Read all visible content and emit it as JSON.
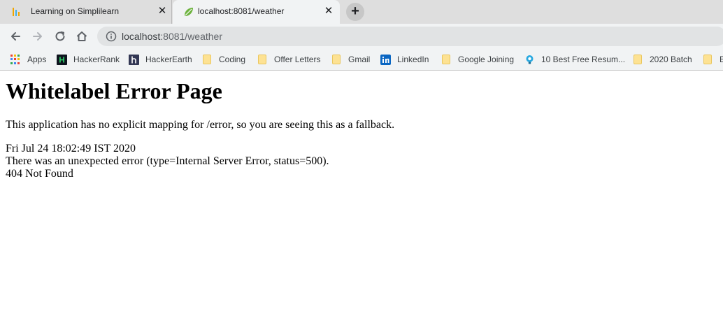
{
  "tabs": [
    {
      "title": "Learning on Simplilearn",
      "active": false
    },
    {
      "title": "localhost:8081/weather",
      "active": true
    }
  ],
  "toolbar": {
    "url_host": "localhost",
    "url_path": ":8081/weather"
  },
  "bookmarks": [
    {
      "label": "Apps",
      "icon": "apps-grid-icon"
    },
    {
      "label": "HackerRank",
      "icon": "hackerrank-icon"
    },
    {
      "label": "HackerEarth",
      "icon": "hackerearth-icon"
    },
    {
      "label": "Coding",
      "icon": "folder-icon"
    },
    {
      "label": "Offer Letters",
      "icon": "folder-icon"
    },
    {
      "label": "Gmail",
      "icon": "folder-icon"
    },
    {
      "label": "LinkedIn",
      "icon": "linkedin-icon"
    },
    {
      "label": "Google Joining",
      "icon": "folder-icon"
    },
    {
      "label": "10 Best Free Resum...",
      "icon": "lightbulb-icon"
    },
    {
      "label": "2020 Batch",
      "icon": "folder-icon"
    },
    {
      "label": "E",
      "icon": "folder-icon"
    }
  ],
  "page": {
    "heading": "Whitelabel Error Page",
    "description": "This application has no explicit mapping for /error, so you are seeing this as a fallback.",
    "timestamp": "Fri Jul 24 18:02:49 IST 2020",
    "error_line": "There was an unexpected error (type=Internal Server Error, status=500).",
    "message": "404 Not Found"
  },
  "colors": {
    "tabstrip_bg": "#dedede",
    "toolbar_bg": "#f1f3f4",
    "folder_yellow": "#fde293",
    "hackerrank_green": "#2ec866",
    "linkedin_blue": "#0a66c2",
    "spring_green": "#6db33f"
  }
}
